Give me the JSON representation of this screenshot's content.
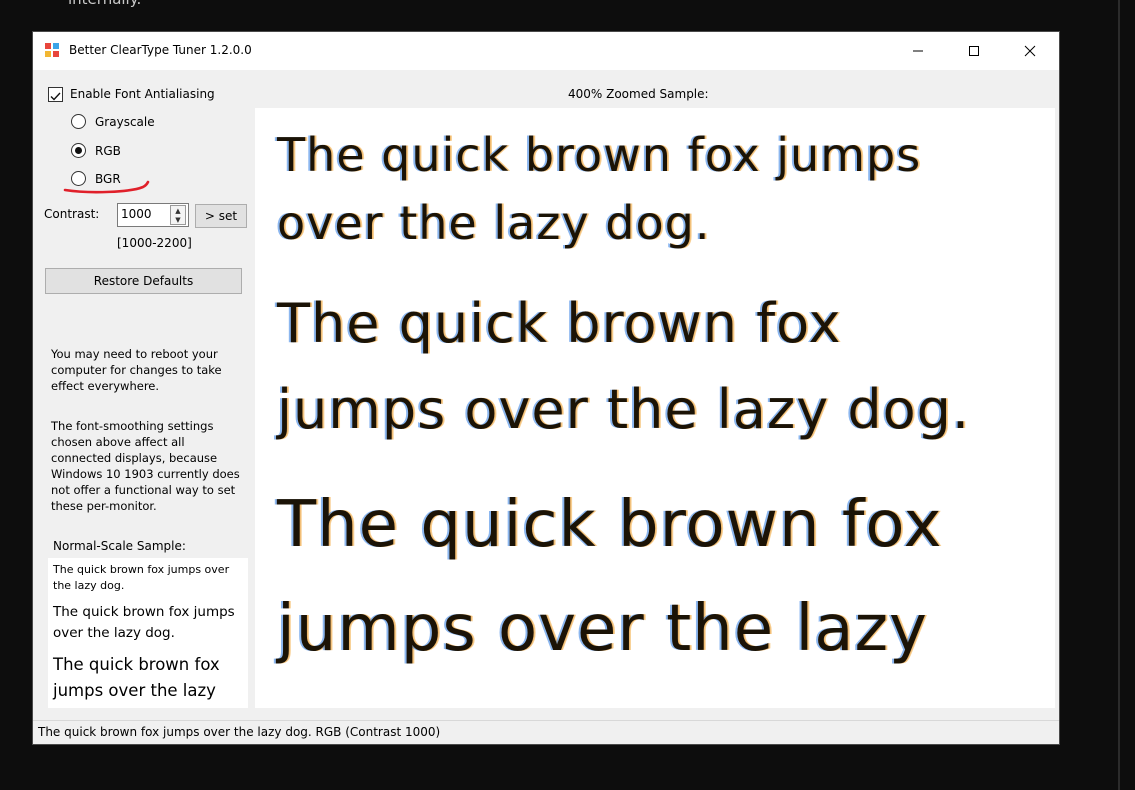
{
  "background": {
    "caption": "internally."
  },
  "window": {
    "title": "Better ClearType Tuner 1.2.0.0",
    "controls": {
      "minimize": "–",
      "maximize": "☐",
      "close": "✕"
    }
  },
  "options": {
    "enable_antialiasing_label": "Enable Font Antialiasing",
    "enable_antialiasing_checked": true,
    "modes": [
      {
        "label": "Grayscale",
        "selected": false
      },
      {
        "label": "RGB",
        "selected": true
      },
      {
        "label": "BGR",
        "selected": false
      }
    ],
    "contrast_label": "Contrast:",
    "contrast_value": "1000",
    "set_button_label": "> set",
    "contrast_range": "[1000-2200]",
    "restore_defaults_label": "Restore Defaults"
  },
  "notes": {
    "reboot": "You may need to reboot your computer for changes to take effect everywhere.",
    "displays": "The font-smoothing settings chosen above affect all connected displays, because Windows 10 1903 currently does not offer a functional way to set these per-monitor."
  },
  "normal_sample": {
    "label": "Normal-Scale Sample:",
    "lines": [
      "The quick brown fox jumps over the lazy dog.",
      "The quick brown fox jumps over the lazy dog.",
      "The quick brown fox jumps over the lazy"
    ]
  },
  "zoomed_sample": {
    "label": "400% Zoomed Sample:",
    "lines": [
      "The quick brown fox jumps",
      "over the lazy dog.",
      "The quick brown fox",
      "jumps over the lazy dog.",
      "The quick brown fox",
      "jumps over the lazy"
    ]
  },
  "status_bar": {
    "text": "The quick brown fox jumps over the lazy dog. RGB (Contrast 1000)"
  },
  "colors": {
    "annotation_red": "#e0202a",
    "window_bg": "#f0f0f0",
    "page_bg": "#0d0d0d"
  }
}
